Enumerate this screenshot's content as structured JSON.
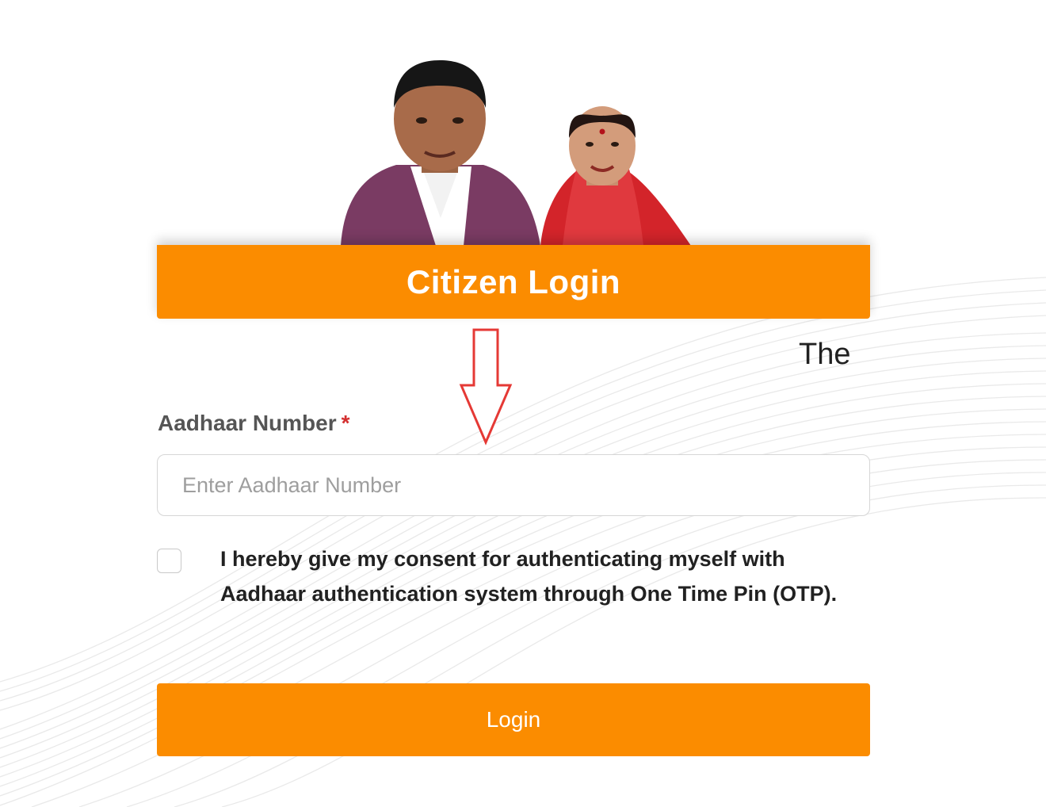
{
  "header": {
    "title": "Citizen Login"
  },
  "marquee": {
    "text": "The"
  },
  "aadhaar": {
    "label": "Aadhaar Number",
    "required_mark": "*",
    "placeholder": "Enter Aadhaar Number",
    "value": ""
  },
  "consent": {
    "checked": false,
    "text": "I hereby give my consent for authenticating myself with Aadhaar authentication system through One Time Pin (OTP)."
  },
  "login_button": {
    "label": "Login"
  },
  "colors": {
    "accent": "#fb8c00",
    "annotation_arrow": "#e53935",
    "required": "#d32f2f"
  },
  "icons": {
    "annotation": "down-arrow-icon"
  }
}
